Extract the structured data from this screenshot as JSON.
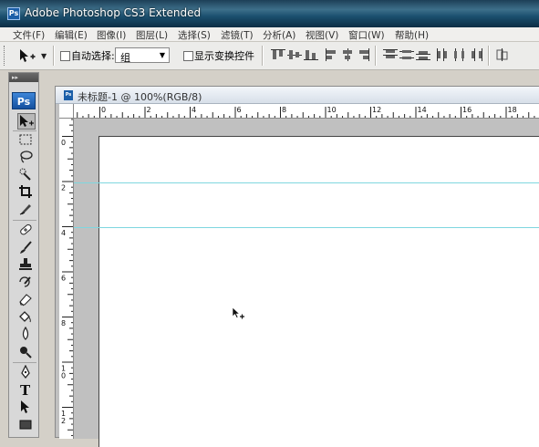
{
  "window": {
    "title": "Adobe Photoshop CS3 Extended",
    "app_icon": "Ps"
  },
  "menubar": {
    "items": [
      "文件(F)",
      "编辑(E)",
      "图像(I)",
      "图层(L)",
      "选择(S)",
      "滤镜(T)",
      "分析(A)",
      "视图(V)",
      "窗口(W)",
      "帮助(H)"
    ]
  },
  "options_bar": {
    "tool_icon": "move-tool-icon",
    "auto_select_label": "自动选择:",
    "auto_select_checked": false,
    "auto_select_value": "组",
    "show_transform_label": "显示变换控件",
    "show_transform_checked": false,
    "align_icons": [
      "align-top-icon",
      "align-vertical-centers-icon",
      "align-bottom-icon",
      "align-left-icon",
      "align-horizontal-centers-icon",
      "align-right-icon"
    ],
    "distribute_icons": [
      "distribute-top-icon",
      "distribute-vcenter-icon",
      "distribute-bottom-icon",
      "distribute-left-icon",
      "distribute-hcenter-icon",
      "distribute-right-icon"
    ],
    "auto_align_icon": "auto-align-layers-icon"
  },
  "tools_panel": {
    "header": "▸▸",
    "logo": "Ps",
    "tools": [
      "move-tool",
      "marquee-tool",
      "lasso-tool",
      "quick-selection-tool",
      "crop-tool",
      "slice-tool",
      "spot-healing-brush-tool",
      "brush-tool",
      "clone-stamp-tool",
      "history-brush-tool",
      "eraser-tool",
      "paint-bucket-tool",
      "blur-tool",
      "dodge-tool",
      "pen-tool",
      "type-tool",
      "path-selection-tool",
      "rectangle-tool"
    ],
    "active_tool": "move-tool"
  },
  "document": {
    "title": "未标题-1 @ 100%(RGB/8)",
    "icon": "Ps",
    "h_ruler_labels": [
      "0",
      "2",
      "4",
      "6",
      "8",
      "10",
      "12",
      "14",
      "16",
      "18"
    ],
    "v_ruler_labels": [
      "0",
      "2",
      "4",
      "6",
      "8",
      "10",
      "12"
    ]
  },
  "colors": {
    "guide": "#7fd7df",
    "canvas": "#ffffff",
    "pasteboard": "#c0c0c0",
    "ps_blue": "#1c5fa8"
  }
}
